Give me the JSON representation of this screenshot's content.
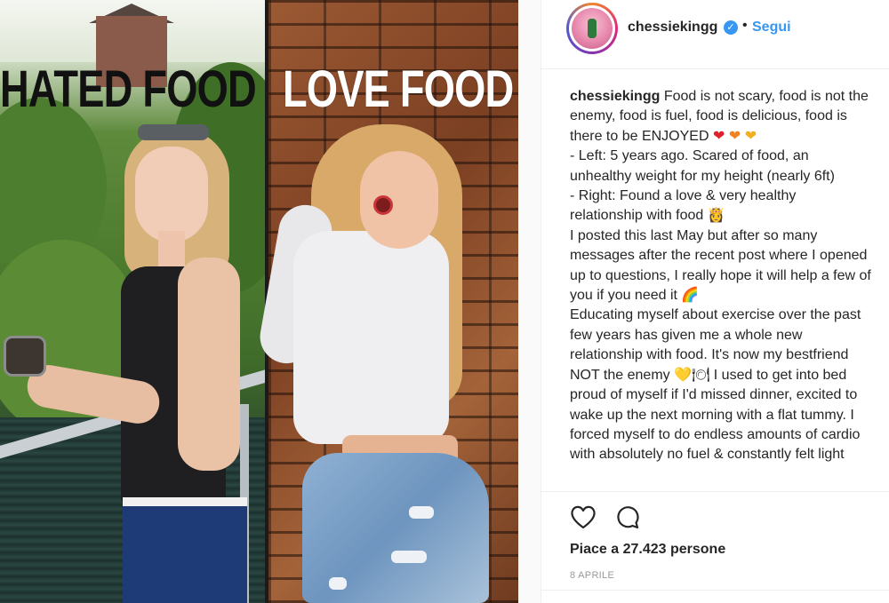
{
  "image": {
    "overlay_left": "HATED FOOD",
    "overlay_right": "LOVE FOOD"
  },
  "header": {
    "username": "chessiekingg",
    "verified_icon": "verified-badge-icon",
    "separator": "•",
    "follow_label": "Segui"
  },
  "caption": {
    "username": "chessiekingg",
    "line_1": "Food is not scary, food is not the enemy, food is fuel, food is delicious, food is there to be ENJOYED",
    "line_1_emoji": [
      "❤",
      "❤",
      "❤"
    ],
    "line_2": "- Left: 5 years ago. Scared of food, an unhealthy weight for my height (nearly 6ft)",
    "line_3": "- Right: Found a love & very healthy relationship with food",
    "line_3_emoji": "👸",
    "line_4": "I posted this last May but after so many messages after the recent post where I opened up to questions, I really hope it will help a few of you if you need it",
    "line_4_emoji": "🌈",
    "line_5": "Educating myself about exercise over the past few years has given me a whole new relationship with food. It's now my bestfriend NOT the enemy",
    "line_5_emoji": "💛🍽",
    "line_6": "I used to get into bed proud of myself if I'd missed dinner, excited to wake up the next morning with a flat tummy. I forced myself to do endless amounts of cardio with absolutely no fuel & constantly felt light"
  },
  "actions": {
    "like_icon": "heart-icon",
    "comment_icon": "comment-icon",
    "likes_text": "Piace a 27.423 persone",
    "date_text": "8 APRILE"
  },
  "colors": {
    "link_blue": "#3897f0",
    "text": "#262626",
    "muted": "#999999"
  }
}
